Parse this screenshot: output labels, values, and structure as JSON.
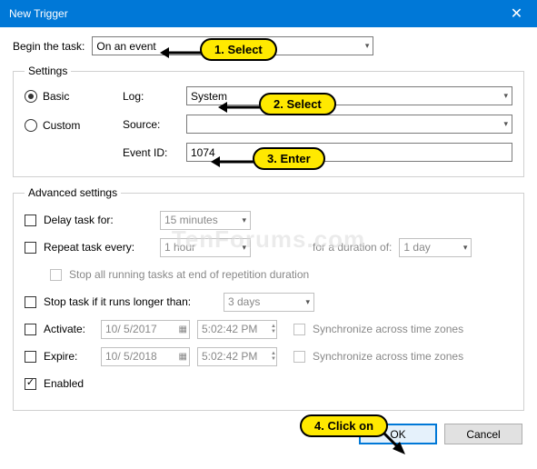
{
  "window": {
    "title": "New Trigger"
  },
  "begin": {
    "label": "Begin the task:",
    "value": "On an event"
  },
  "settings": {
    "legend": "Settings",
    "radio_basic": "Basic",
    "radio_custom": "Custom",
    "log_label": "Log:",
    "log_value": "System",
    "source_label": "Source:",
    "source_value": "",
    "eventid_label": "Event ID:",
    "eventid_value": "1074"
  },
  "adv": {
    "legend": "Advanced settings",
    "delay_label": "Delay task for:",
    "delay_value": "15 minutes",
    "repeat_label": "Repeat task every:",
    "repeat_value": "1 hour",
    "duration_label": "for a duration of:",
    "duration_value": "1 day",
    "stop_repeat_label": "Stop all running tasks at end of repetition duration",
    "stop_runs_label": "Stop task if it runs longer than:",
    "stop_runs_value": "3 days",
    "activate_label": "Activate:",
    "activate_date": "10/ 5/2017",
    "activate_time": "5:02:42 PM",
    "expire_label": "Expire:",
    "expire_date": "10/ 5/2018",
    "expire_time": "5:02:42 PM",
    "sync_label": "Synchronize across time zones",
    "enabled_label": "Enabled"
  },
  "buttons": {
    "ok": "OK",
    "cancel": "Cancel"
  },
  "callouts": {
    "c1": "1. Select",
    "c2": "2. Select",
    "c3": "3. Enter",
    "c4": "4. Click on"
  },
  "watermark": "TenForums.com"
}
